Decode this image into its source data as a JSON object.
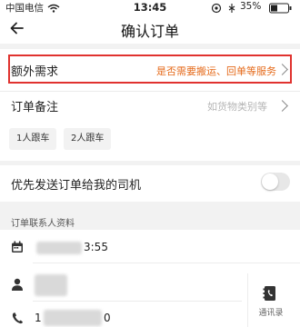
{
  "status_bar": {
    "carrier": "中国电信",
    "time": "13:45",
    "battery": "35%"
  },
  "nav": {
    "title": "确认订单"
  },
  "extra": {
    "label": "额外需求",
    "value": "是否需要搬运、回单等服务"
  },
  "remarks": {
    "label": "订单备注",
    "hint": "如货物类别等",
    "chips": [
      "1人跟车",
      "2人跟车"
    ]
  },
  "priority": {
    "label": "优先发送订单给我的司机",
    "enabled": false
  },
  "contact": {
    "header": "订单联系人资料",
    "time_suffix": "3:55",
    "phone_prefix": "1",
    "phone_suffix": "0",
    "address_book_label": "通讯录"
  },
  "colors": {
    "highlight_border": "#e0322f",
    "accent_text": "#e56a1a"
  }
}
